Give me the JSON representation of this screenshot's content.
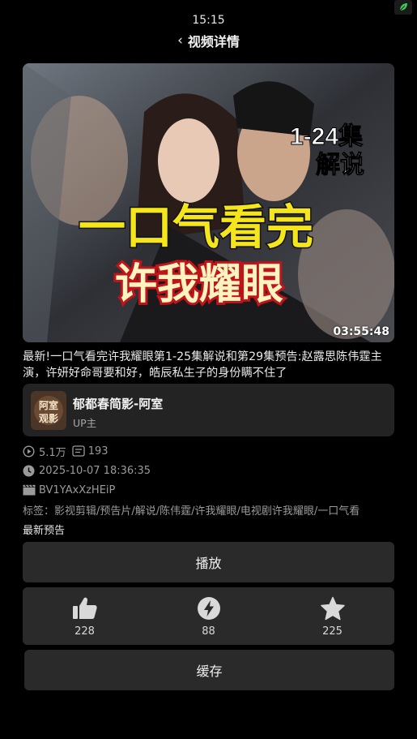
{
  "status": {
    "time": "15:15"
  },
  "header": {
    "title": "视频详情",
    "back_icon": "chevron-left-icon"
  },
  "video": {
    "thumbnail": {
      "top_right_text_1": "1-24集",
      "top_right_text_2": "解说",
      "main_text": "一口气看完",
      "sub_text": "许我耀眼"
    },
    "duration": "03:55:48",
    "description": "最新!一口气看完许我耀眼第1-25集解说和第29集预告:赵露思陈伟霆主演，许妍好命哥要和好，皓辰私生子的身份瞒不住了"
  },
  "uploader": {
    "avatar_text": "阿室观影",
    "name": "郁都春简影-阿室",
    "role": "UP主"
  },
  "stats": {
    "views": "5.1万",
    "danmaku": "193",
    "date": "2025-10-07 18:36:35",
    "bvid": "BV1YAxXzHEiP"
  },
  "tags": {
    "line1": "标签：影视剪辑/预告片/解说/陈伟霆/许我耀眼/电视剧许我耀眼/一口气看",
    "line2": "最新预告"
  },
  "buttons": {
    "play": "播放",
    "cache": "缓存"
  },
  "actions": [
    {
      "icon": "thumbs-up-icon",
      "count": "228"
    },
    {
      "icon": "lightning-coin-icon",
      "count": "88"
    },
    {
      "icon": "star-icon",
      "count": "225"
    }
  ],
  "colors": {
    "background": "#000000",
    "card": "#2a2a2a",
    "accent_yellow": "#f5e51b",
    "accent_red": "#d61d1d"
  }
}
